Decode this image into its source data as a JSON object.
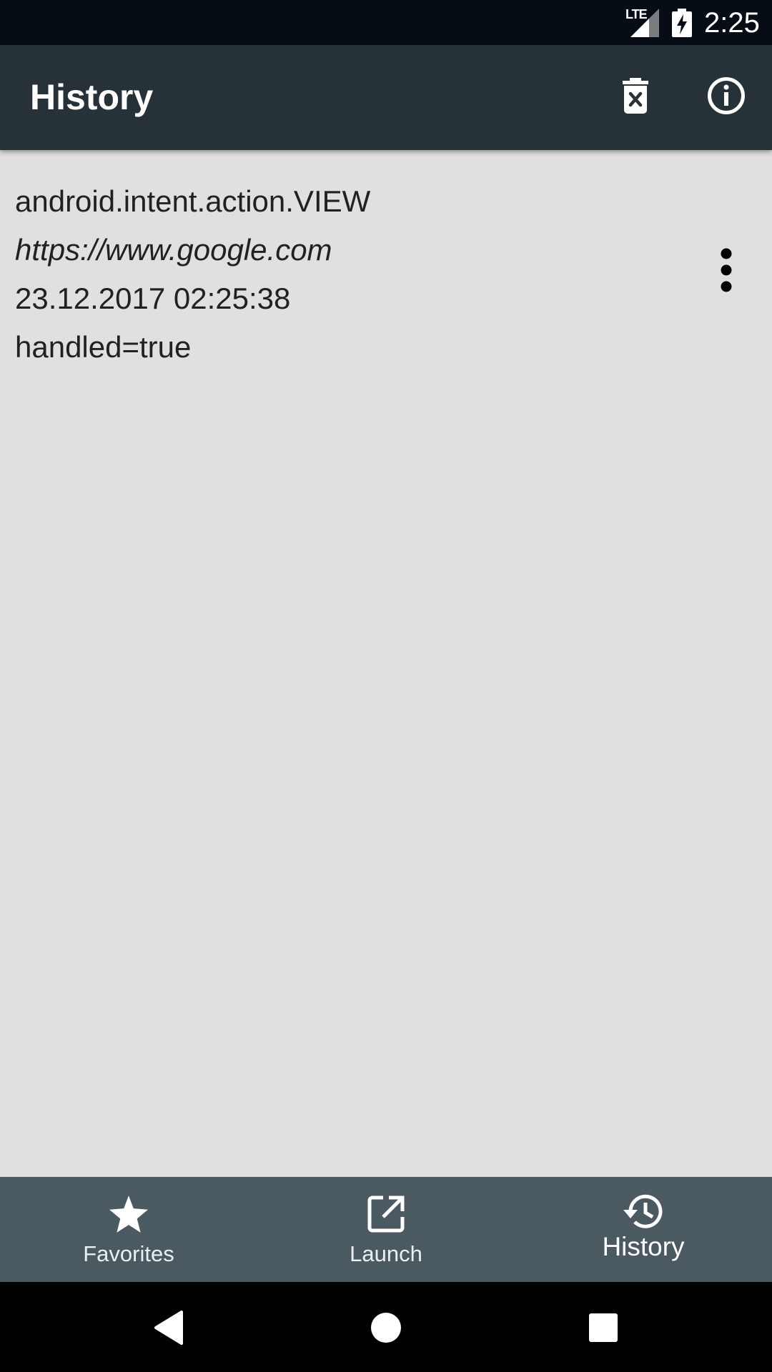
{
  "status_bar": {
    "network": "LTE",
    "time": "2:25"
  },
  "app_bar": {
    "title": "History",
    "actions": [
      {
        "icon": "delete-sweep-icon",
        "label": "Clear history"
      },
      {
        "icon": "info-icon",
        "label": "Info"
      }
    ]
  },
  "history": {
    "items": [
      {
        "action": "android.intent.action.VIEW",
        "uri": "https://www.google.com",
        "timestamp": "23.12.2017 02:25:38",
        "handled": "handled=true"
      }
    ]
  },
  "bottom_nav": {
    "items": [
      {
        "label": "Favorites",
        "icon": "star-icon",
        "active": false
      },
      {
        "label": "Launch",
        "icon": "open-in-new-icon",
        "active": false
      },
      {
        "label": "History",
        "icon": "history-icon",
        "active": true
      }
    ]
  },
  "system_nav": {
    "buttons": [
      "back",
      "home",
      "recents"
    ]
  },
  "colors": {
    "status_bar": "#060d15",
    "app_bar": "#263238",
    "content_bg": "#e0e0e0",
    "bottom_nav": "#4b5961",
    "system_nav": "#000000"
  }
}
